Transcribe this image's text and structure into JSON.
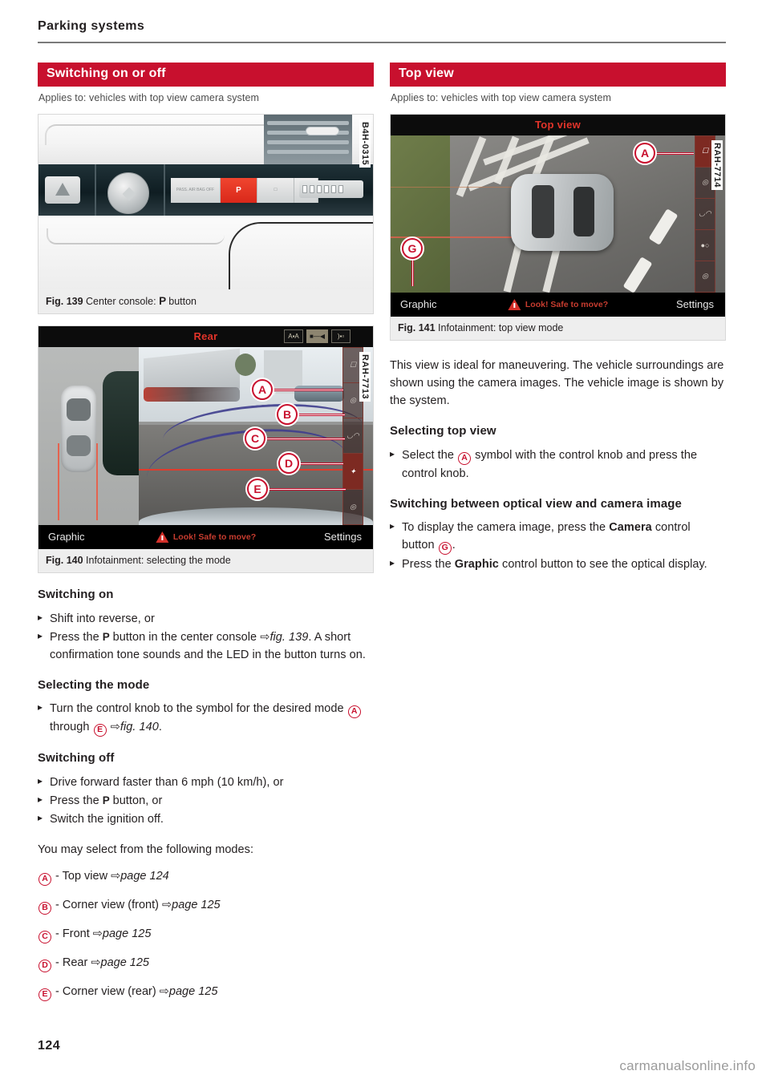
{
  "running_head": "Parking systems",
  "page_number": "124",
  "watermark": "carmanualsonline.info",
  "accent_color": "#c8102e",
  "left_column": {
    "section": {
      "title": "Switching on or off",
      "applies_to": "Applies to: vehicles with top view camera system"
    },
    "figure_139": {
      "code": "B4H-0315",
      "caption_label": "Fig. 139",
      "caption_text": "Center console: P button",
      "caption_prefix": "Center console: ",
      "caption_suffix": " button",
      "button_glyph": "P",
      "console_buttons": {
        "airbag": "PASS. AIR BAG OFF",
        "park": "P",
        "camera": "camera-icon"
      }
    },
    "figure_140": {
      "code": "RAH-7713",
      "screen_title": "Rear",
      "caption_label": "Fig. 140",
      "caption_text": "Infotainment: selecting the mode",
      "bottom_left": "Graphic",
      "bottom_center": "Look! Safe to move?",
      "bottom_right": "Settings",
      "callouts": [
        "A",
        "B",
        "C",
        "D",
        "E"
      ]
    },
    "switching_on": {
      "heading": "Switching on",
      "steps": [
        "Shift into reverse, or",
        "Press the P button in the center console fig. 139. A short confirmation tone sounds and the LED in the button turns on."
      ],
      "step2_p1": "Press the ",
      "step2_btn": "P",
      "step2_p2": " button in the center console",
      "step2_ref": "fig. 139",
      "step2_p3": ". A short confirmation tone sounds and the LED in the button turns on."
    },
    "selecting_mode": {
      "heading": "Selecting the mode",
      "step_p1": "Turn the control knob to the symbol for the desired mode ",
      "ref_a": "A",
      "step_p2": " through ",
      "ref_e": "E",
      "step_ref": "fig. 140",
      "step_p3": "."
    },
    "switching_off": {
      "heading": "Switching off",
      "step1": "Drive forward faster than 6 mph (10 km/h), or",
      "step2_p1": "Press the ",
      "step2_btn": "P",
      "step2_p2": " button, or",
      "step3": "Switch the ignition off."
    },
    "modes_intro": "You may select from the following modes:",
    "modes": [
      {
        "ref": "A",
        "label": "- Top view ",
        "page": "page 124"
      },
      {
        "ref": "B",
        "label": "- Corner view (front) ",
        "page": "page 125"
      },
      {
        "ref": "C",
        "label": "- Front ",
        "page": "page 125"
      },
      {
        "ref": "D",
        "label": "- Rear ",
        "page": "page 125"
      },
      {
        "ref": "E",
        "label": "- Corner view (rear) ",
        "page": "page 125"
      }
    ]
  },
  "right_column": {
    "section": {
      "title": "Top view",
      "applies_to": "Applies to: vehicles with top view camera system"
    },
    "figure_141": {
      "code": "RAH-7714",
      "screen_title": "Top view",
      "caption_label": "Fig. 141",
      "caption_text": "Infotainment: top view mode",
      "bottom_left": "Graphic",
      "bottom_center": "Look! Safe to move?",
      "bottom_right": "Settings",
      "callouts": [
        "A",
        "G"
      ]
    },
    "intro": "This view is ideal for maneuvering. The vehicle surroundings are shown using the camera images. The vehicle image is shown by the system.",
    "selecting_top_view": {
      "heading": "Selecting top view",
      "step_p1": "Select the ",
      "ref_a": "A",
      "step_p2": " symbol with the control knob and press the control knob."
    },
    "switching_optical": {
      "heading": "Switching between optical view and camera image",
      "step1_p1": "To display the camera image, press the ",
      "step1_bold": "Camera",
      "step1_p2": " control button ",
      "step1_ref": "G",
      "step1_p3": ".",
      "step2_p1": "Press the ",
      "step2_bold": "Graphic",
      "step2_p2": " control button to see the optical display."
    }
  }
}
